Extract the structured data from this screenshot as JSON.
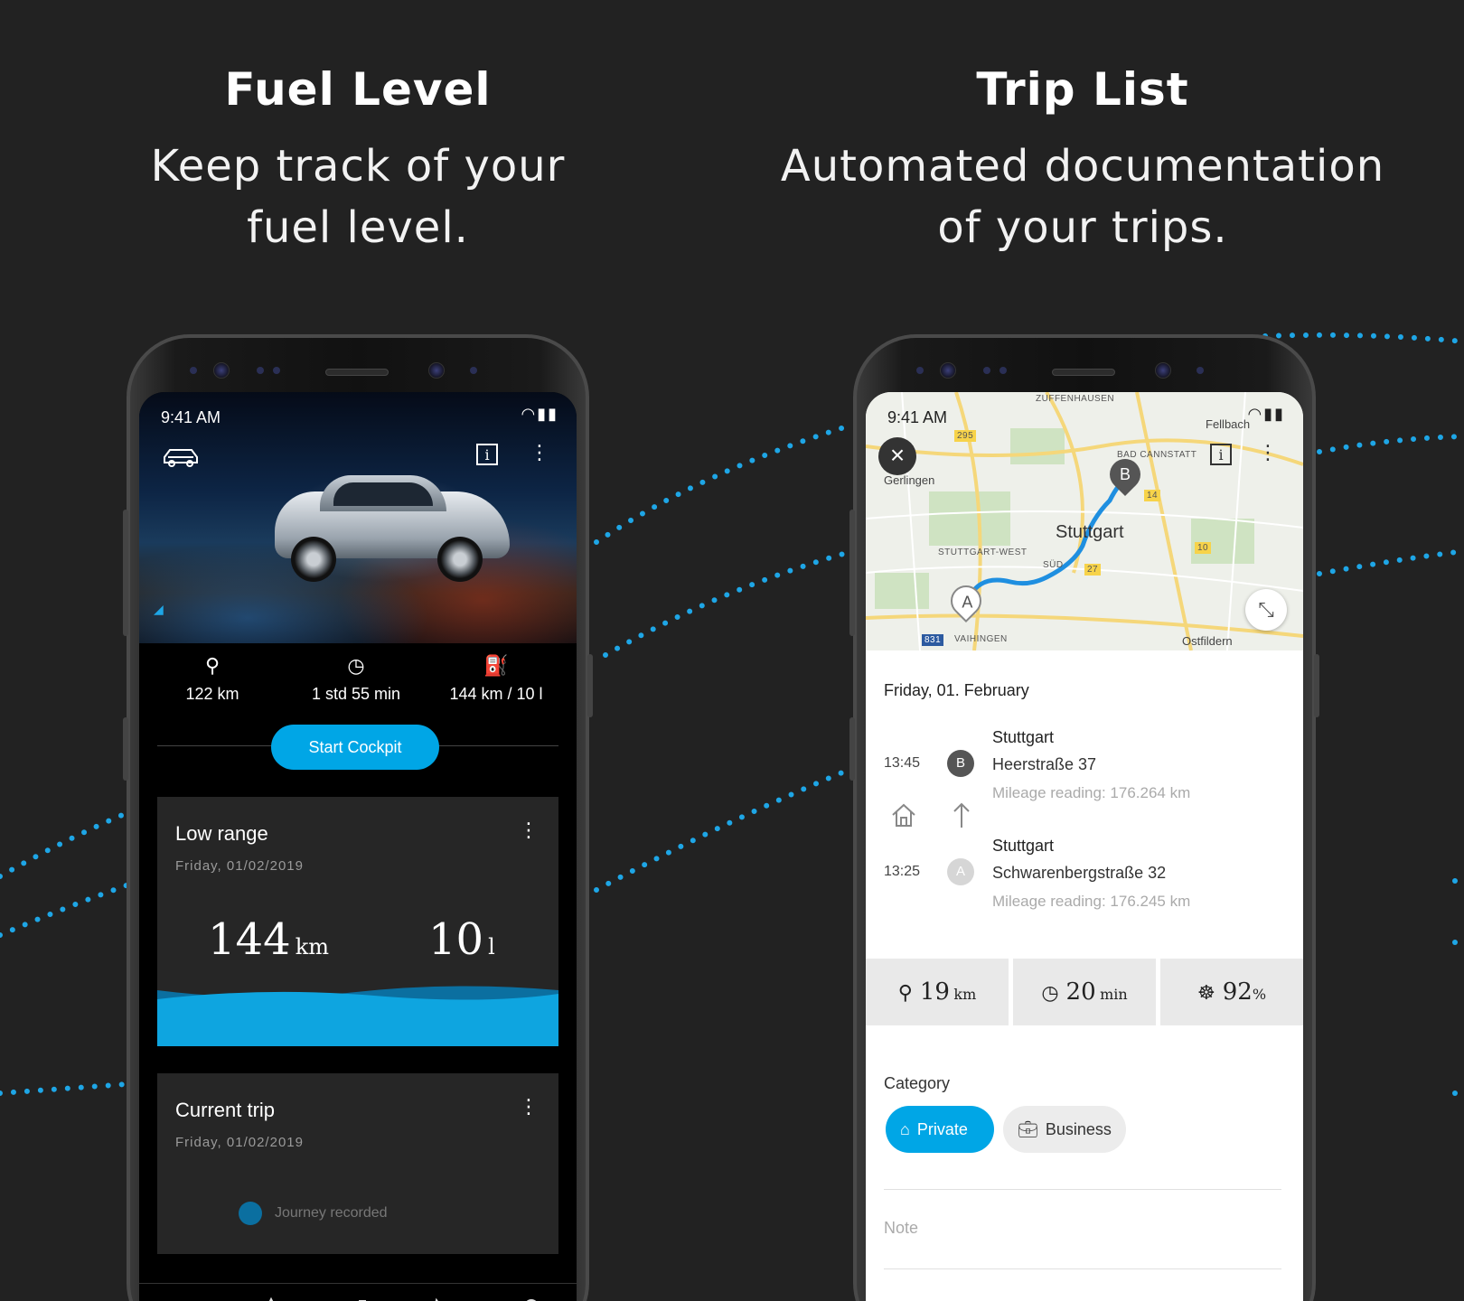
{
  "left_panel": {
    "title": "Fuel Level",
    "subtitle_line1": "Keep track of your",
    "subtitle_line2": "fuel level."
  },
  "right_panel": {
    "title": "Trip List",
    "subtitle_line1": "Automated documentation",
    "subtitle_line2": "of your trips."
  },
  "accent_color": "#00a6e6",
  "fuel_screen": {
    "status_time": "9:41 AM",
    "stats": [
      {
        "icon": "range-pin-icon",
        "value": "122 km"
      },
      {
        "icon": "clock-icon",
        "value": "1 std 55 min"
      },
      {
        "icon": "fuel-pump-icon",
        "value": "144 km / 10 l"
      }
    ],
    "start_button": "Start Cockpit",
    "low_range_card": {
      "title": "Low range",
      "date": "Friday, 01/02/2019",
      "range_value": "144",
      "range_unit": "km",
      "fuel_value": "10",
      "fuel_unit": "l"
    },
    "current_trip_card": {
      "title": "Current trip",
      "date": "Friday, 01/02/2019",
      "partial_text": "Journey recorded"
    },
    "nav": [
      "car-icon",
      "navigate-icon",
      "stats-icon",
      "wrench-icon",
      "profile-icon"
    ]
  },
  "trip_screen": {
    "status_time": "9:41 AM",
    "map_labels": {
      "zuffenhausen": "ZUFFENHAUSEN",
      "gerlingen": "Gerlingen",
      "fellbach": "Fellbach",
      "bad_cannstatt": "BAD CANNSTATT",
      "stuttgart": "Stuttgart",
      "stuttgart_west": "STUTTGART-WEST",
      "sud": "SÜD",
      "vaihingen": "VAIHINGEN",
      "ostfildern": "Ostfildern",
      "road_295": "295",
      "road_14": "14",
      "road_10": "10",
      "road_27": "27",
      "road_831": "831"
    },
    "trip_date": "Friday, 01. February",
    "destination": {
      "time": "13:45",
      "marker": "B",
      "city": "Stuttgart",
      "street": "Heerstraße 37",
      "mileage": "Mileage reading: 176.264 km"
    },
    "origin": {
      "time": "13:25",
      "marker": "A",
      "city": "Stuttgart",
      "street": "Schwarenbergstraße 32",
      "mileage": "Mileage reading: 176.245 km"
    },
    "metrics": [
      {
        "icon": "range-pin-icon",
        "value": "19",
        "unit": "km"
      },
      {
        "icon": "clock-icon",
        "value": "20",
        "unit": "min"
      },
      {
        "icon": "eco-score-icon",
        "value": "92",
        "unit": "%"
      }
    ],
    "category_label": "Category",
    "category_options": [
      {
        "label": "Private",
        "selected": true
      },
      {
        "label": "Business",
        "selected": false
      }
    ],
    "note_placeholder": "Note"
  }
}
